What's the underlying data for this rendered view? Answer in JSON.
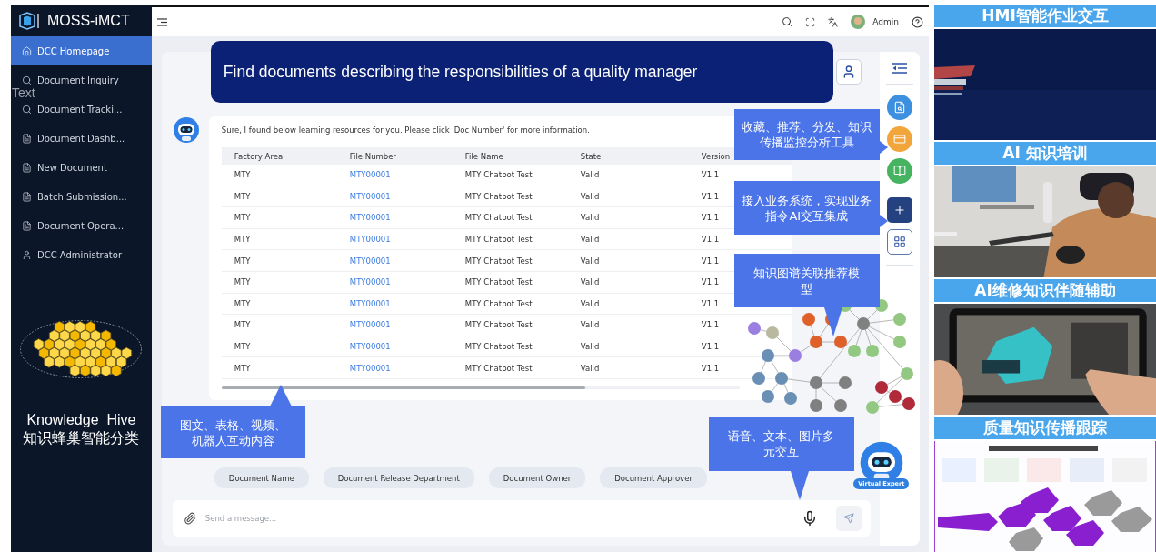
{
  "sidebar": {
    "brand": "MOSS-iMCT",
    "items": [
      {
        "label": "DCC Homepage",
        "selected": true
      },
      {
        "label": "Document Inquiry",
        "selected": false
      },
      {
        "label": "Document Tracki...",
        "selected": false
      },
      {
        "label": "Document Dashb...",
        "selected": false
      },
      {
        "label": "New Document",
        "selected": false
      },
      {
        "label": "Batch Submission...",
        "selected": false
      },
      {
        "label": "Document Opera...",
        "selected": false
      },
      {
        "label": "DCC Administrator",
        "selected": false
      }
    ],
    "hive_caption": [
      "Knowledge  Hive",
      "知识蜂巢智能分类"
    ]
  },
  "stray_label": "Text",
  "header": {
    "user": "Admin"
  },
  "query": "Find documents describing the responsibilities of a quality manager",
  "answer": {
    "text": "Sure, I found below learning resources for you. Please click 'Doc Number' for more information.",
    "columns": [
      {
        "label": "Factory Area",
        "kind": "text"
      },
      {
        "label": "File Number",
        "kind": "link"
      },
      {
        "label": "File Name",
        "kind": "text"
      },
      {
        "label": "State",
        "kind": "text"
      },
      {
        "label": "Version",
        "kind": "text"
      }
    ],
    "rows": [
      [
        "MTY",
        "MTY00001",
        "MTY Chatbot Test",
        "Valid",
        "V1.1"
      ],
      [
        "MTY",
        "MTY00001",
        "MTY Chatbot Test",
        "Valid",
        "V1.1"
      ],
      [
        "MTY",
        "MTY00001",
        "MTY Chatbot Test",
        "Valid",
        "V1.1"
      ],
      [
        "MTY",
        "MTY00001",
        "MTY Chatbot Test",
        "Valid",
        "V1.1"
      ],
      [
        "MTY",
        "MTY00001",
        "MTY Chatbot Test",
        "Valid",
        "V1.1"
      ],
      [
        "MTY",
        "MTY00001",
        "MTY Chatbot Test",
        "Valid",
        "V1.1"
      ],
      [
        "MTY",
        "MTY00001",
        "MTY Chatbot Test",
        "Valid",
        "V1.1"
      ],
      [
        "MTY",
        "MTY00001",
        "MTY Chatbot Test",
        "Valid",
        "V1.1"
      ],
      [
        "MTY",
        "MTY00001",
        "MTY Chatbot Test",
        "Valid",
        "V1.1"
      ],
      [
        "MTY",
        "MTY00001",
        "MTY Chatbot Test",
        "Valid",
        "V1.1"
      ]
    ]
  },
  "chips": [
    "Document Name",
    "Document Release Department",
    "Document Owner",
    "Document Approver"
  ],
  "input": {
    "placeholder": "Send a message..."
  },
  "toolbar": [
    {
      "kind": "search-doc",
      "color": "#3d8fe0"
    },
    {
      "kind": "card",
      "color": "#f2a53a"
    },
    {
      "kind": "book",
      "color": "#46b361"
    },
    {
      "kind": "plus",
      "color": "#24427f"
    },
    {
      "kind": "grid",
      "color": "#ffffff"
    }
  ],
  "virtual_expert": "Virtual Expert",
  "callouts": [
    "收藏、推荐、分发、知识传播监控分析工具",
    "接入业务系统，实现业务指令AI交互集成",
    "知识图谱关联推荐模型",
    "图文、表格、视频、机器人互动内容",
    "语音、文本、图片多元交互"
  ],
  "panels": [
    {
      "title": "HMI智能作业交互"
    },
    {
      "title": "AI 知识培训"
    },
    {
      "title": "AI维修知识伴随辅助"
    },
    {
      "title": "质量知识传播跟踪"
    }
  ]
}
